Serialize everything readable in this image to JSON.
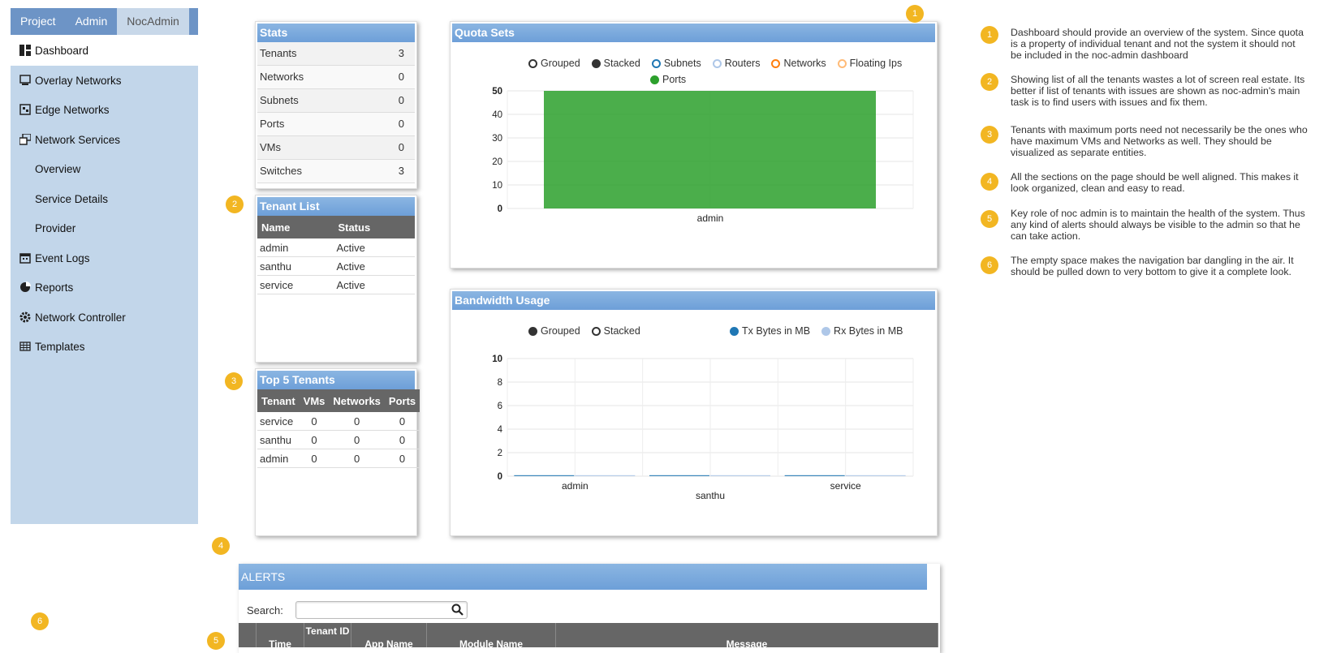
{
  "nav_tabs": [
    "Project",
    "Admin",
    "NocAdmin"
  ],
  "sidebar": [
    {
      "label": "Dashboard",
      "icon": "dashboard-icon"
    },
    {
      "label": "Overlay Networks",
      "icon": "monitor-icon"
    },
    {
      "label": "Edge Networks",
      "icon": "edge-network-icon"
    },
    {
      "label": "Network Services",
      "icon": "network-services-icon"
    },
    {
      "label": "Overview"
    },
    {
      "label": "Service Details"
    },
    {
      "label": "Provider"
    },
    {
      "label": "Event Logs",
      "icon": "calendar-icon"
    },
    {
      "label": "Reports",
      "icon": "pie-chart-icon"
    },
    {
      "label": "Network Controller",
      "icon": "gear-icon"
    },
    {
      "label": "Templates",
      "icon": "table-icon"
    }
  ],
  "stats": {
    "title": "Stats",
    "rows": [
      {
        "label": "Tenants",
        "value": "3"
      },
      {
        "label": "Networks",
        "value": "0"
      },
      {
        "label": "Subnets",
        "value": "0"
      },
      {
        "label": "Ports",
        "value": "0"
      },
      {
        "label": "VMs",
        "value": "0"
      },
      {
        "label": "Switches",
        "value": "3"
      }
    ]
  },
  "tenant_list": {
    "title": "Tenant List",
    "headers": [
      "Name",
      "Status"
    ],
    "rows": [
      [
        "admin",
        "Active"
      ],
      [
        "santhu",
        "Active"
      ],
      [
        "service",
        "Active"
      ]
    ]
  },
  "top_tenants": {
    "title": "Top 5 Tenants",
    "headers": [
      "Tenant",
      "VMs",
      "Networks",
      "Ports"
    ],
    "rows": [
      [
        "service",
        "0",
        "0",
        "0"
      ],
      [
        "santhu",
        "0",
        "0",
        "0"
      ],
      [
        "admin",
        "0",
        "0",
        "0"
      ]
    ]
  },
  "quota": {
    "title": "Quota Sets",
    "modes": [
      "Grouped",
      "Stacked"
    ],
    "legend": [
      {
        "name": "Subnets",
        "color": "#1f77b4",
        "filled": false
      },
      {
        "name": "Routers",
        "color": "#aec7e8",
        "filled": false
      },
      {
        "name": "Networks",
        "color": "#ff7f0e",
        "filled": false
      },
      {
        "name": "Floating Ips",
        "color": "#ffbb78",
        "filled": false
      },
      {
        "name": "Ports",
        "color": "#2ca02c",
        "filled": true
      }
    ]
  },
  "bandwidth": {
    "title": "Bandwidth Usage",
    "modes": [
      "Grouped",
      "Stacked"
    ],
    "legend": [
      {
        "name": "Tx Bytes in MB",
        "color": "#1f77b4"
      },
      {
        "name": "Rx Bytes in MB",
        "color": "#aec7e8"
      }
    ]
  },
  "chart_data": [
    {
      "type": "bar",
      "title": "Quota Sets",
      "categories": [
        "admin"
      ],
      "series": [
        {
          "name": "Ports",
          "values": [
            50
          ]
        }
      ],
      "ylim": [
        0,
        50
      ],
      "yticks": [
        0,
        10,
        20,
        30,
        40,
        50
      ],
      "grid": true,
      "legend": "top"
    },
    {
      "type": "bar",
      "title": "Bandwidth Usage",
      "categories": [
        "admin",
        "santhu",
        "service"
      ],
      "series": [
        {
          "name": "Tx Bytes in MB",
          "values": [
            0,
            0,
            0
          ]
        },
        {
          "name": "Rx Bytes in MB",
          "values": [
            0,
            0,
            0
          ]
        }
      ],
      "ylim": [
        0,
        10
      ],
      "yticks": [
        0,
        2,
        4,
        6,
        8,
        10
      ],
      "grid": true,
      "legend": "top"
    }
  ],
  "alerts": {
    "title": "ALERTS",
    "search_label": "Search:",
    "columns": [
      "Time",
      "Tenant ID",
      "App Name",
      "Module Name",
      "Message"
    ]
  },
  "annotations": [
    {
      "num": "1",
      "text": "Dashboard should provide an overview of the system. Since quota is a property of individual tenant and not the system it should not be included in the noc-admin dashboard"
    },
    {
      "num": "2",
      "text": "Showing list of all the tenants wastes a lot of screen real estate. Its better if list of tenants with issues are shown as noc-admin's main task is to find users with issues and fix them."
    },
    {
      "num": "3",
      "text": "Tenants with maximum ports need not necessarily be the ones who have maximum VMs and Networks as well. They should be visualized as separate entities."
    },
    {
      "num": "4",
      "text": "All the sections on the page should be well aligned. This makes it look organized, clean and easy to read."
    },
    {
      "num": "5",
      "text": "Key role of noc admin is to maintain the health of the system. Thus any kind of alerts should always be visible to the admin so that he can take action."
    },
    {
      "num": "6",
      "text": "The empty space makes the navigation bar dangling in the air. It should be pulled down to very bottom to give it a complete look."
    }
  ]
}
